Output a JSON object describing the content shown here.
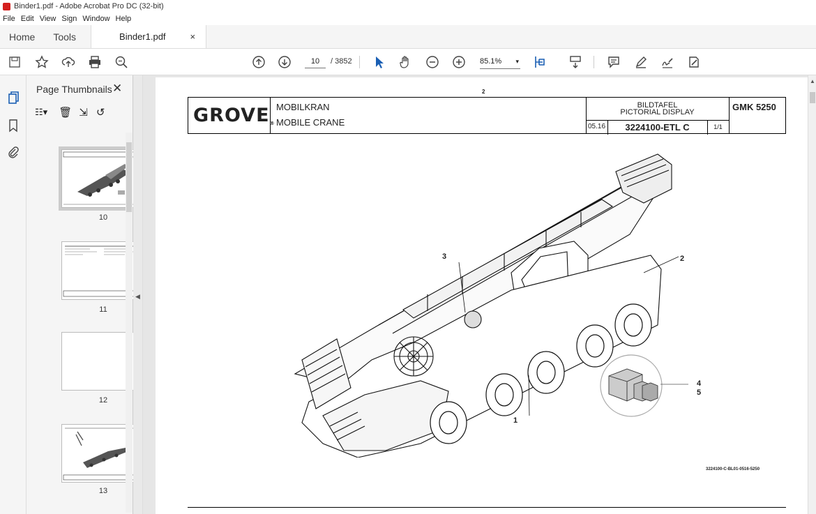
{
  "window": {
    "title": "Binder1.pdf - Adobe Acrobat Pro DC (32-bit)"
  },
  "menu": [
    "File",
    "Edit",
    "View",
    "Sign",
    "Window",
    "Help"
  ],
  "tabs": {
    "home": "Home",
    "tools": "Tools",
    "document": "Binder1.pdf",
    "close": "×"
  },
  "toolbar": {
    "current_page": "10",
    "total_pages": "/ 3852",
    "zoom": "85.1%"
  },
  "panel": {
    "title": "Page Thumbnails",
    "close": "✕",
    "thumbnails": [
      {
        "page": "10",
        "selected": true
      },
      {
        "page": "11",
        "selected": false
      },
      {
        "page": "12",
        "selected": false
      },
      {
        "page": "13",
        "selected": false
      }
    ]
  },
  "document": {
    "page_marker": "2",
    "logo": "GROVE",
    "logo_mark": "®",
    "title_de": "MOBILKRAN",
    "title_en": "MOBILE CRANE",
    "display_de": "BILDTAFEL",
    "display_en": "PICTORIAL DISPLAY",
    "date": "05.16",
    "part_number": "3224100-ETL C",
    "sheet": "1/1",
    "model": "GMK 5250",
    "callouts": [
      "1",
      "2",
      "3",
      "4",
      "5"
    ],
    "drawing_ref": "3224100-C-BL01-0516-5250"
  }
}
